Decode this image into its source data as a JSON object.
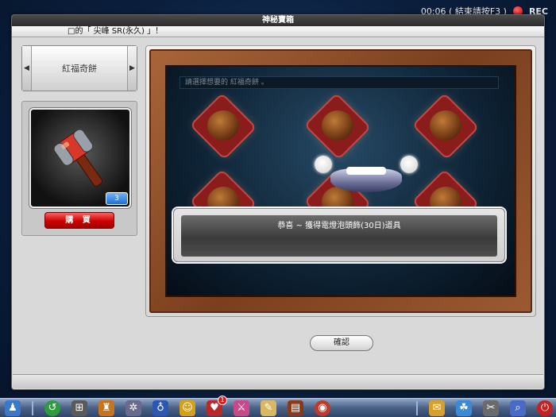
{
  "status": {
    "timer_text": "00:06 ( 結束請按F3 )",
    "rec_label": "REC"
  },
  "window": {
    "title": "神秘寶箱",
    "marquee": "□的「 尖峰 SR(永久) 」！"
  },
  "selector": {
    "label": "紅福奇餅"
  },
  "item": {
    "quantity": "3",
    "buy_label": "購 買"
  },
  "board": {
    "prompt": "請選擇想要的 紅福奇餅 。",
    "bag_count": 6
  },
  "dialog": {
    "message": "恭喜 ~ 獲得電燈泡頭飾(30日)道具"
  },
  "confirm_label": "確認",
  "taskbar": {
    "notification_count": "1"
  }
}
